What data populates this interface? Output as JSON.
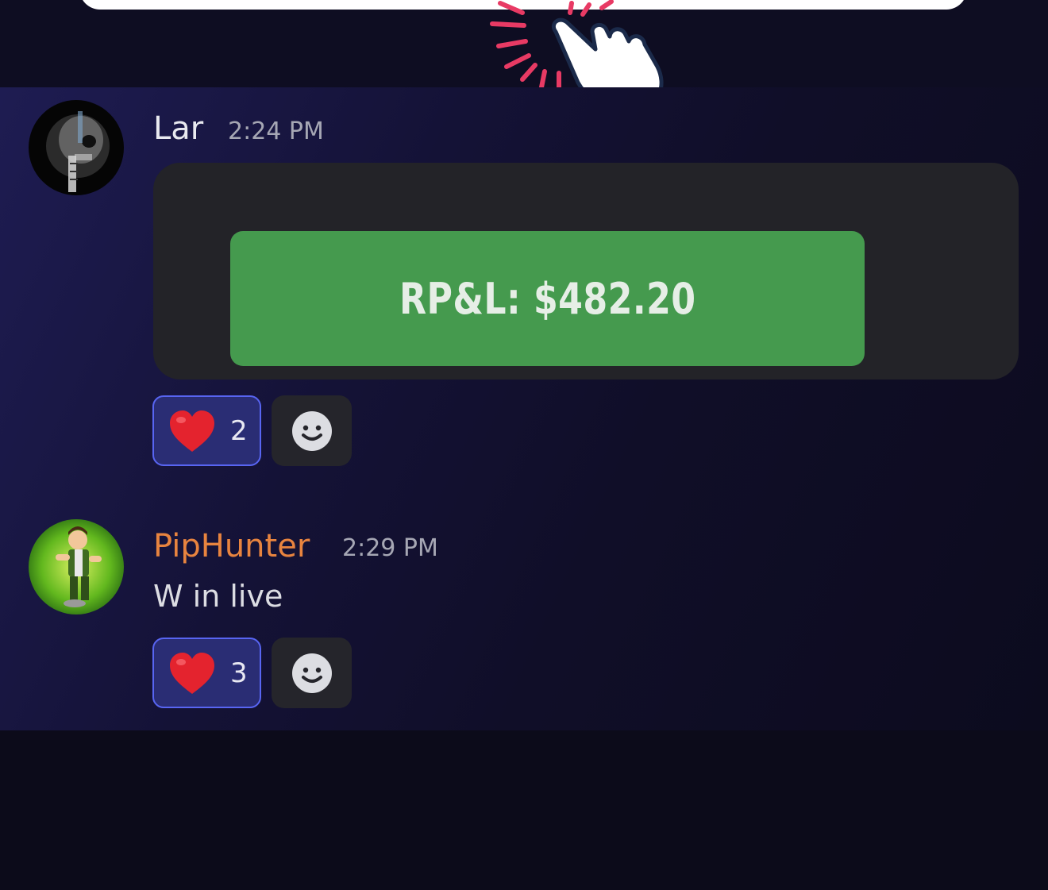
{
  "colors": {
    "accent_reaction_border": "#5865f2",
    "reaction_bg": "#2a2d74",
    "pnl_button": "#459a4e",
    "username_lar": "#e9eaf0",
    "username_piphunter": "#e8843f"
  },
  "messages": [
    {
      "author": "Lar",
      "time": "2:24 PM",
      "avatar_icon": "skull-xray-avatar-icon",
      "embed": {
        "button_label": "RP&L: $482.20"
      },
      "reaction": {
        "emoji_icon": "heart-icon",
        "count": "2"
      },
      "add_reaction_icon": "smiley-icon"
    },
    {
      "author": "PipHunter",
      "time": "2:29 PM",
      "avatar_icon": "cartoon-hero-avatar-icon",
      "text": "W in live",
      "reaction": {
        "emoji_icon": "heart-icon",
        "count": "3"
      },
      "add_reaction_icon": "smiley-icon"
    }
  ]
}
